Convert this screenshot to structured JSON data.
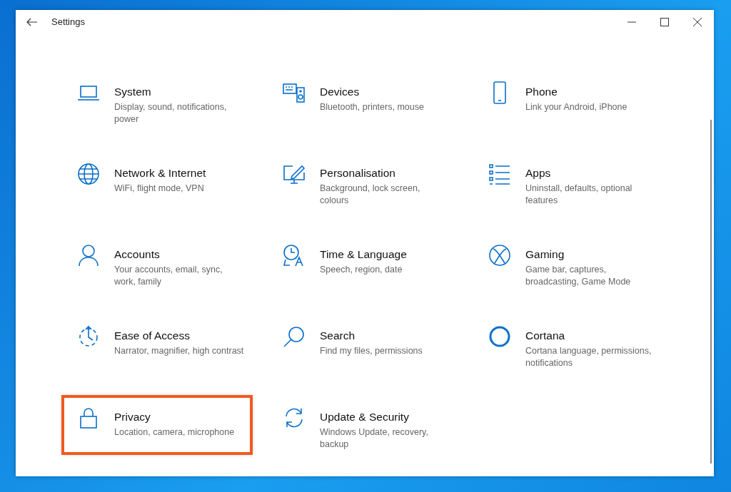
{
  "window": {
    "title": "Settings"
  },
  "items": [
    {
      "title": "System",
      "description": "Display, sound, notifications, power",
      "highlighted": false
    },
    {
      "title": "Devices",
      "description": "Bluetooth, printers, mouse",
      "highlighted": false
    },
    {
      "title": "Phone",
      "description": "Link your Android, iPhone",
      "highlighted": false
    },
    {
      "title": "Network & Internet",
      "description": "WiFi, flight mode, VPN",
      "highlighted": false
    },
    {
      "title": "Personalisation",
      "description": "Background, lock screen, colours",
      "highlighted": false
    },
    {
      "title": "Apps",
      "description": "Uninstall, defaults, optional features",
      "highlighted": false
    },
    {
      "title": "Accounts",
      "description": "Your accounts, email, sync, work, family",
      "highlighted": false
    },
    {
      "title": "Time & Language",
      "description": "Speech, region, date",
      "highlighted": false
    },
    {
      "title": "Gaming",
      "description": "Game bar, captures, broadcasting, Game Mode",
      "highlighted": false
    },
    {
      "title": "Ease of Access",
      "description": "Narrator, magnifier, high contrast",
      "highlighted": false
    },
    {
      "title": "Search",
      "description": "Find my files, permissions",
      "highlighted": false
    },
    {
      "title": "Cortana",
      "description": "Cortana language, permissions, notifications",
      "highlighted": false
    },
    {
      "title": "Privacy",
      "description": "Location, camera, microphone",
      "highlighted": true
    },
    {
      "title": "Update & Security",
      "description": "Windows Update, recovery, backup",
      "highlighted": false
    }
  ]
}
